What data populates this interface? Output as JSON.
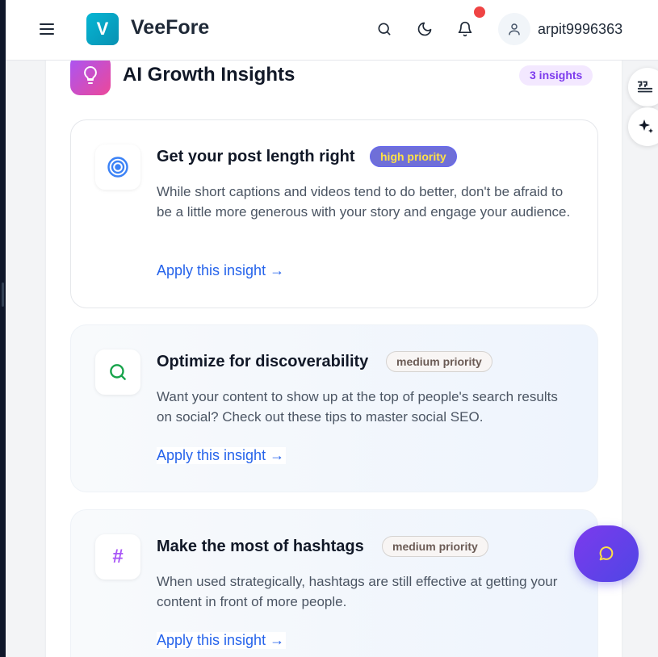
{
  "header": {
    "logo_letter": "V",
    "brand": "VeeFore",
    "username": "arpit9996363"
  },
  "section": {
    "title": "AI Growth Insights",
    "count_badge": "3 insights"
  },
  "insights": [
    {
      "title": "Get your post length right",
      "priority": "high priority",
      "description": "While short captions and videos tend to do better, don't be afraid to be a little more generous with your story and engage your audience.",
      "action": "Apply this insight →",
      "icon": "target-icon"
    },
    {
      "title": "Optimize for discoverability",
      "priority": "medium priority",
      "description": "Want your content to show up at the top of people's search results on social? Check out these tips to master social SEO.",
      "action": "Apply this insight →",
      "icon": "search-icon"
    },
    {
      "title": "Make the most of hashtags",
      "priority": "medium priority",
      "description": "When used strategically, hashtags are still effective at getting your content in front of more people.",
      "action": "Apply this insight →",
      "icon": "hashtag-icon",
      "icon_glyph": "#"
    }
  ],
  "colors": {
    "brand": "#06b6d4",
    "accent_purple": "#7c3aed",
    "link": "#2563eb",
    "high_priority_bg": "#6f6fd8",
    "high_priority_text": "#fde047",
    "notification": "#ef4444"
  },
  "icons": [
    "menu-icon",
    "search-icon",
    "moon-icon",
    "bell-icon",
    "user-icon",
    "lightbulb-icon",
    "quote-icon",
    "sparkles-icon",
    "chat-icon"
  ]
}
